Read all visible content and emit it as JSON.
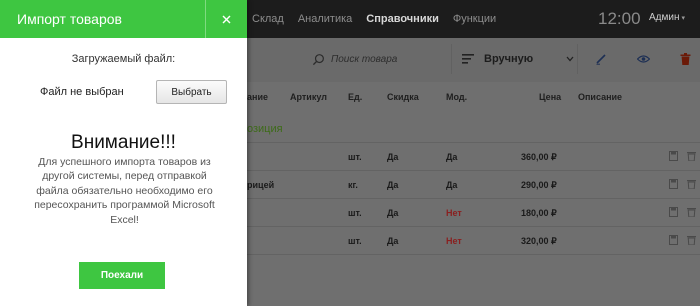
{
  "app": {
    "nav": [
      "Склад",
      "Аналитика",
      "Справочники",
      "Функции"
    ],
    "nav_active_index": 2,
    "clock": "12:00",
    "user": "Админ"
  },
  "toolbar": {
    "search_placeholder": "Поиск товара",
    "sort_value": "Вручную",
    "icons": [
      "search-icon",
      "list-lines-icon",
      "pencil-icon",
      "eye-icon",
      "trash-icon"
    ]
  },
  "table": {
    "headers": [
      "ание",
      "Артикул",
      "Ед.",
      "Скидка",
      "Мод.",
      "Цена",
      "Описание"
    ],
    "group_label": "озиция",
    "rows": [
      {
        "name": "",
        "unit": "шт.",
        "discount": "Да",
        "mod": "Да",
        "price": "360,00 ₽"
      },
      {
        "name": "рицей",
        "unit": "кг.",
        "discount": "Да",
        "mod": "Да",
        "price": "290,00 ₽"
      },
      {
        "name": "",
        "unit": "шт.",
        "discount": "Да",
        "mod": "Нет",
        "price": "180,00 ₽"
      },
      {
        "name": "",
        "unit": "шт.",
        "discount": "Да",
        "mod": "Нет",
        "price": "320,00 ₽"
      }
    ]
  },
  "panel": {
    "title": "Импорт товаров",
    "upload_caption": "Загружаемый файл:",
    "file_status": "Файл не выбран",
    "choose_label": "Выбрать",
    "warning_title": "Внимание!!!",
    "warning_text": "Для успешного импорта товаров из другой системы, перед отправкой файла обязательно необходимо его пересохранить программой Microsoft Excel!",
    "submit_label": "Поехали"
  },
  "colors": {
    "accent_green": "#3ec641",
    "topbar": "#1c1c1c",
    "overlay_bg": "#6f6f6f",
    "no_red": "#8a1f1f"
  }
}
